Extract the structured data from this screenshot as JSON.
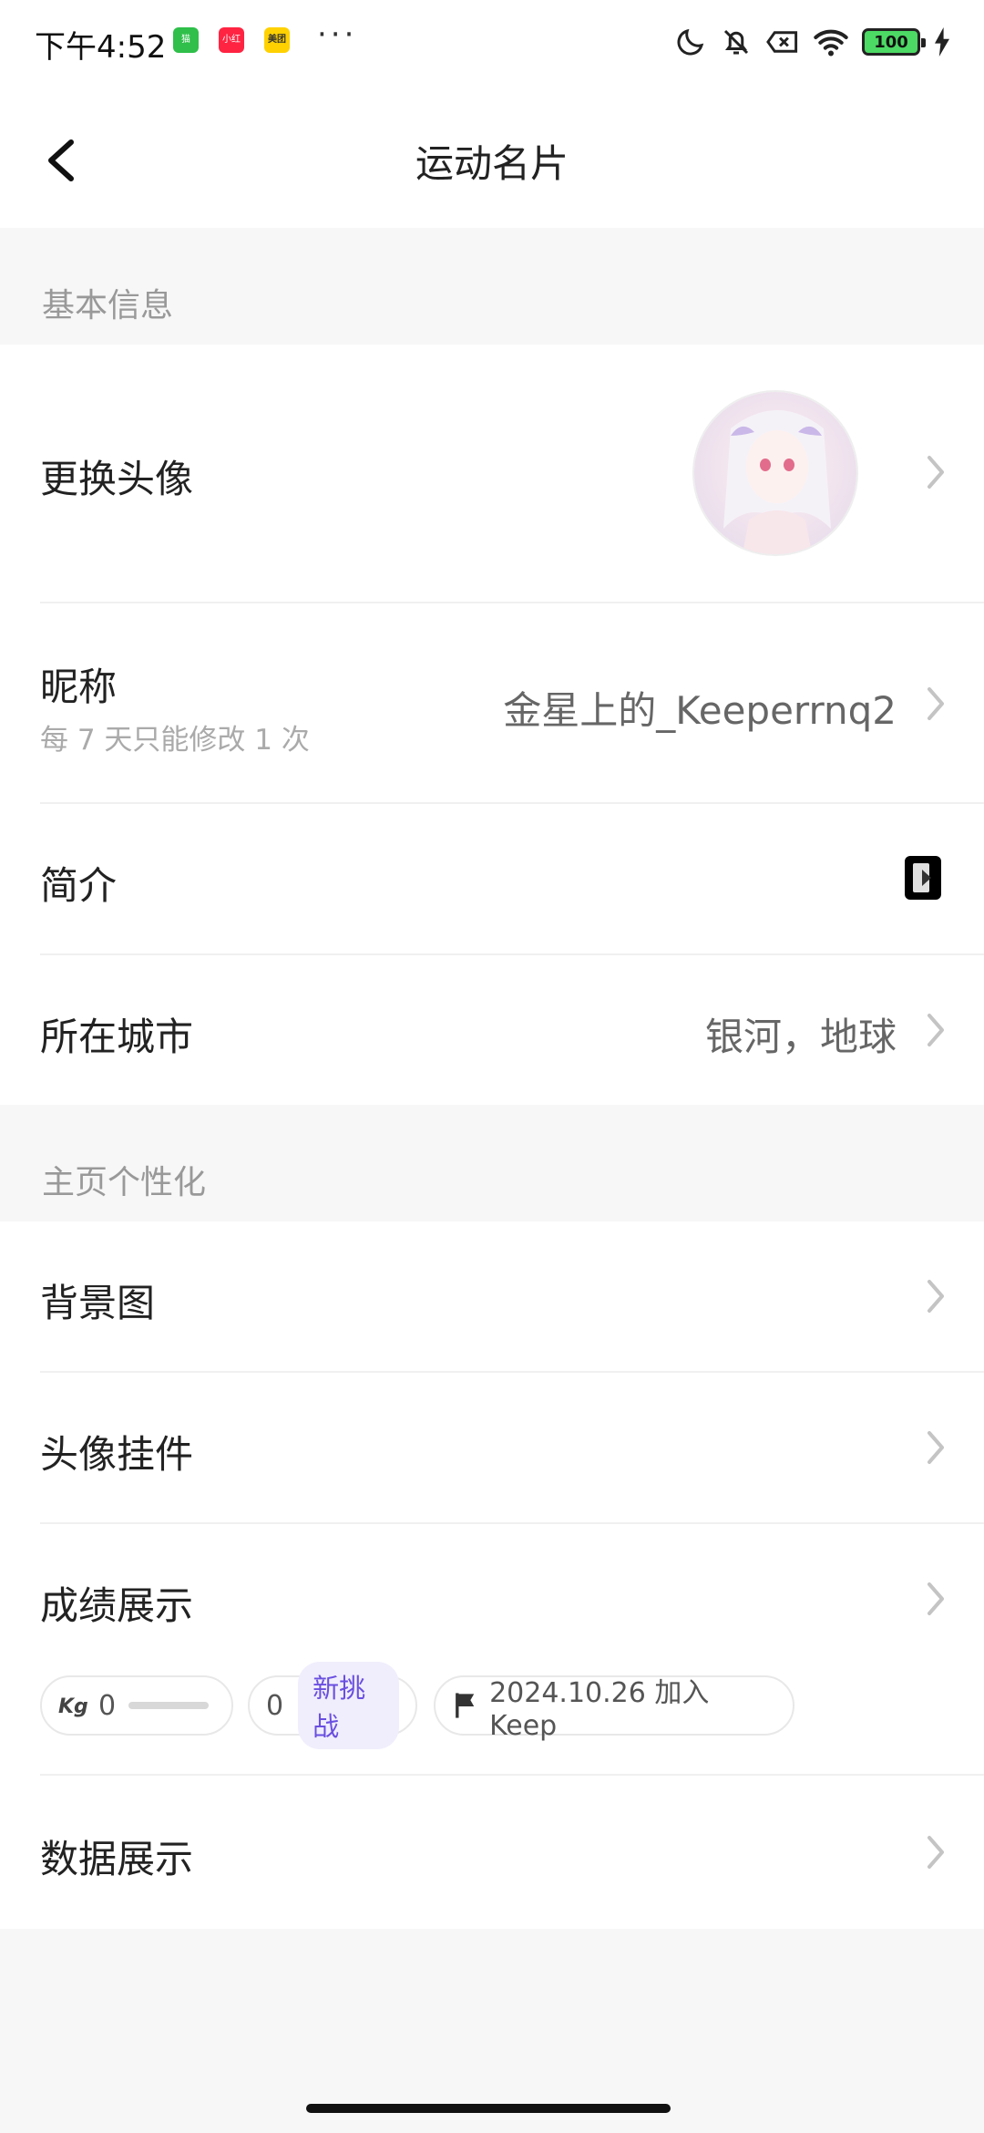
{
  "status_bar": {
    "time": "下午4:52",
    "app1": "猫",
    "app2": "小红书",
    "app3": "美团",
    "more": "···",
    "battery": "100"
  },
  "header": {
    "title": "运动名片"
  },
  "basic_info": {
    "section_label": "基本信息",
    "avatar_label": "更换头像",
    "nickname_label": "昵称",
    "nickname_hint": "每 7 天只能修改 1 次",
    "nickname_value": "金星上的_Keeperrnq2",
    "bio_label": "简介",
    "city_label": "所在城市",
    "city_value": "银河，地球"
  },
  "personalization": {
    "section_label": "主页个性化",
    "background_label": "背景图",
    "avatar_pendant_label": "头像挂件",
    "achievements_label": "成绩展示",
    "data_display_label": "数据展示"
  },
  "achievements": {
    "kg_value": "0",
    "challenge_count": "0",
    "challenge_tag": "新挑战",
    "join_text": "2024.10.26 加入 Keep"
  },
  "colors": {
    "accent_purple": "#6a4fe0",
    "label_gray": "#999999",
    "background": "#f7f7f7"
  }
}
